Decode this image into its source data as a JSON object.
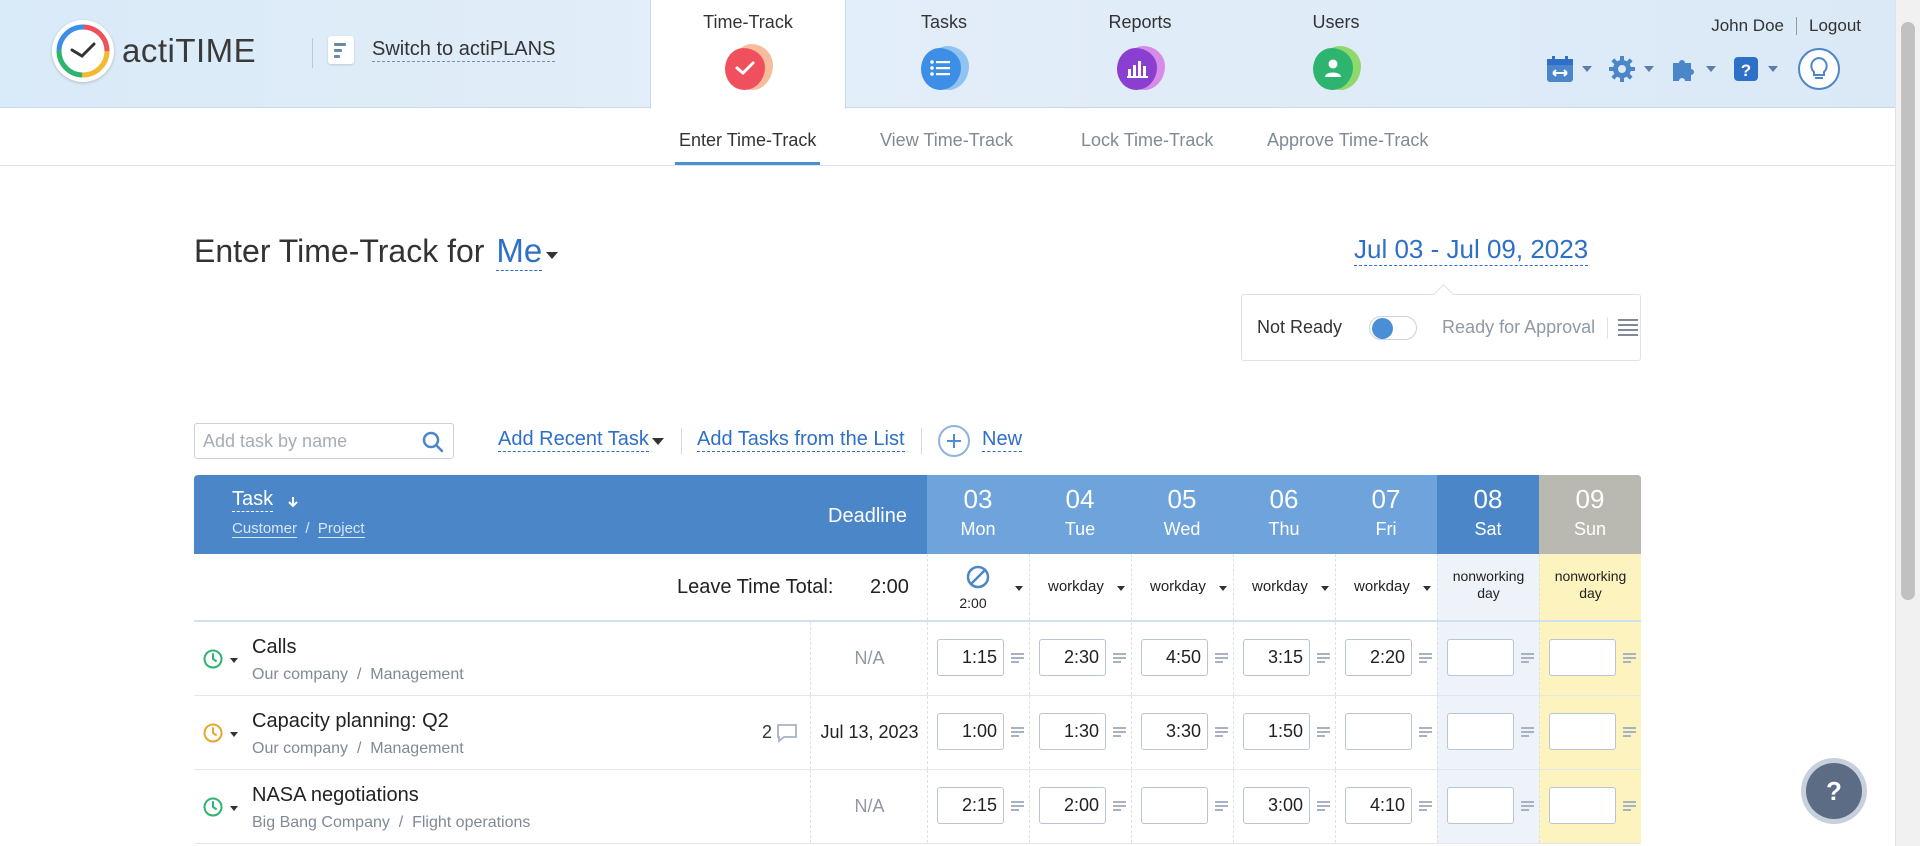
{
  "header": {
    "logo_text": "actiTIME",
    "switch_label": "Switch to actiPLANS",
    "modules": [
      {
        "label": "Time-Track",
        "color": "#f0505e"
      },
      {
        "label": "Tasks",
        "color": "#3d8ee6"
      },
      {
        "label": "Reports",
        "color": "#8a3fd1"
      },
      {
        "label": "Users",
        "color": "#2db46e"
      }
    ],
    "user_name": "John Doe",
    "logout": "Logout",
    "tools": [
      "calendar-icon",
      "gear-icon",
      "puzzle-icon",
      "help-icon",
      "lightbulb-icon"
    ]
  },
  "subnav": {
    "tabs": [
      "Enter Time-Track",
      "View Time-Track",
      "Lock Time-Track",
      "Approve Time-Track"
    ],
    "active": "Enter Time-Track"
  },
  "page": {
    "title": "Enter Time-Track for",
    "user": "Me",
    "date_range": "Jul 03 - Jul 09, 2023",
    "status_not_ready": "Not Ready",
    "status_ready": "Ready for Approval"
  },
  "toolbar": {
    "search_placeholder": "Add task by name",
    "add_recent": "Add Recent Task",
    "add_from_list": "Add Tasks from the List",
    "new": "New"
  },
  "grid": {
    "col_task": "Task",
    "col_customer": "Customer",
    "col_project": "Project",
    "col_separator": "/",
    "col_deadline": "Deadline",
    "days": [
      {
        "num": "03",
        "name": "Mon",
        "type": "leave",
        "leave": "2:00"
      },
      {
        "num": "04",
        "name": "Tue",
        "type": "workday"
      },
      {
        "num": "05",
        "name": "Wed",
        "type": "workday"
      },
      {
        "num": "06",
        "name": "Thu",
        "type": "workday"
      },
      {
        "num": "07",
        "name": "Fri",
        "type": "workday"
      },
      {
        "num": "08",
        "name": "Sat",
        "type": "nonworking"
      },
      {
        "num": "09",
        "name": "Sun",
        "type": "nonworking"
      }
    ],
    "nonworking_line1": "nonworking",
    "nonworking_line2": "day",
    "workday_label": "workday",
    "leave_total_label": "Leave Time Total:",
    "leave_total_value": "2:00",
    "rows": [
      {
        "task": "Calls",
        "customer": "Our company",
        "project": "Management",
        "deadline": "N/A",
        "comments": "",
        "clock_color": "#2db46e",
        "times": [
          "1:15",
          "2:30",
          "4:50",
          "3:15",
          "2:20",
          "",
          ""
        ]
      },
      {
        "task": "Capacity planning: Q2",
        "customer": "Our company",
        "project": "Management",
        "deadline": "Jul 13, 2023",
        "comments": "2",
        "clock_color": "#e3a92b",
        "times": [
          "1:00",
          "1:30",
          "3:30",
          "1:50",
          "",
          "",
          ""
        ]
      },
      {
        "task": "NASA negotiations",
        "customer": "Big Bang Company",
        "project": "Flight operations",
        "deadline": "N/A",
        "comments": "",
        "clock_color": "#2db46e",
        "times": [
          "2:15",
          "2:00",
          "",
          "3:00",
          "4:10",
          "",
          ""
        ]
      }
    ]
  },
  "help_label": "?"
}
